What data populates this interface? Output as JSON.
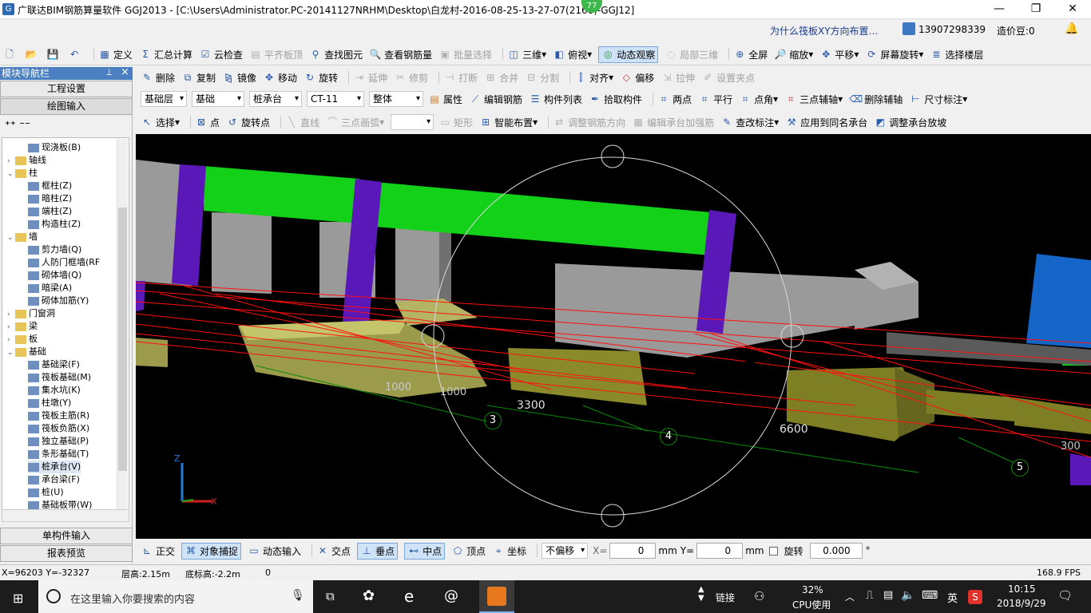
{
  "window": {
    "title": "广联达BIM钢筋算量软件 GGJ2013 - [C:\\Users\\Administrator.PC-20141127NRHM\\Desktop\\白龙村-2016-08-25-13-27-07(2166)-GGJ12]",
    "badge": "77",
    "minimize": "—",
    "maximize": "❐",
    "close": "✕"
  },
  "menubar": {
    "help_link": "为什么筏板XY方向布置…",
    "phone": "13907298339",
    "beans": "造价豆:0"
  },
  "toolbar1": {
    "define": "定义",
    "sum": "汇总计算",
    "cloud_check": "云检查",
    "flat_slab_top": "平齐板顶",
    "find_element": "查找图元",
    "view_rebar": "查看钢筋量",
    "batch_select": "批量选择",
    "three_d": "三维",
    "top_view": "俯视",
    "dynamic_observe": "动态观察",
    "local_3d": "局部三维",
    "fullscreen": "全屏",
    "zoom": "缩放",
    "pan": "平移",
    "screen_rotate": "屏幕旋转",
    "select_floor": "选择楼层"
  },
  "toolbar2": {
    "delete": "删除",
    "copy": "复制",
    "mirror": "镜像",
    "move": "移动",
    "rotate": "旋转",
    "extend": "延伸",
    "trim": "修剪",
    "break": "打断",
    "merge": "合并",
    "split": "分割",
    "align": "对齐",
    "offset": "偏移",
    "stretch": "拉伸",
    "set_grip": "设置夹点"
  },
  "toolbar3": {
    "layer": "基础层",
    "category": "基础",
    "element_type": "桩承台",
    "element_name": "CT-11",
    "scope": "整体",
    "property": "属性",
    "edit_rebar": "编辑钢筋",
    "element_list": "构件列表",
    "pick_element": "拾取构件",
    "two_points": "两点",
    "parallel": "平行",
    "point_angle": "点角",
    "three_point_axis": "三点辅轴",
    "delete_axis": "删除辅轴",
    "dimension": "尺寸标注"
  },
  "toolbar4": {
    "select": "选择",
    "point": "点",
    "rotate_point": "旋转点",
    "line": "直线",
    "three_point_arc": "三点画弧",
    "rect": "矩形",
    "smart_layout": "智能布置",
    "adjust_rebar_dir": "调整钢筋方向",
    "edit_cap_reinforce": "编辑承台加强筋",
    "modify_annotation": "查改标注",
    "apply_same_cap": "应用到同名承台",
    "adjust_cap_slope": "调整承台放坡"
  },
  "nav": {
    "header": "模块导航栏",
    "pin": "ꟷ",
    "close": "×",
    "project_settings": "工程设置",
    "drawing_input": "绘图输入",
    "single_input": "单构件输入",
    "report_preview": "报表预览",
    "tree": [
      {
        "label": "现浇板(B)",
        "level": 2,
        "type": "leaf"
      },
      {
        "label": "轴线",
        "level": 1,
        "type": "folder",
        "exp": "+"
      },
      {
        "label": "柱",
        "level": 1,
        "type": "folder",
        "exp": "−"
      },
      {
        "label": "框柱(Z)",
        "level": 2,
        "type": "leaf"
      },
      {
        "label": "暗柱(Z)",
        "level": 2,
        "type": "leaf"
      },
      {
        "label": "端柱(Z)",
        "level": 2,
        "type": "leaf"
      },
      {
        "label": "构造柱(Z)",
        "level": 2,
        "type": "leaf"
      },
      {
        "label": "墙",
        "level": 1,
        "type": "folder",
        "exp": "−"
      },
      {
        "label": "剪力墙(Q)",
        "level": 2,
        "type": "leaf"
      },
      {
        "label": "人防门框墙(RF",
        "level": 2,
        "type": "leaf"
      },
      {
        "label": "砌体墙(Q)",
        "level": 2,
        "type": "leaf"
      },
      {
        "label": "暗梁(A)",
        "level": 2,
        "type": "leaf"
      },
      {
        "label": "砌体加筋(Y)",
        "level": 2,
        "type": "leaf"
      },
      {
        "label": "门窗洞",
        "level": 1,
        "type": "folder",
        "exp": "+"
      },
      {
        "label": "梁",
        "level": 1,
        "type": "folder",
        "exp": "+"
      },
      {
        "label": "板",
        "level": 1,
        "type": "folder",
        "exp": "+"
      },
      {
        "label": "基础",
        "level": 1,
        "type": "folder",
        "exp": "−"
      },
      {
        "label": "基础梁(F)",
        "level": 2,
        "type": "leaf"
      },
      {
        "label": "筏板基础(M)",
        "level": 2,
        "type": "leaf"
      },
      {
        "label": "集水坑(K)",
        "level": 2,
        "type": "leaf"
      },
      {
        "label": "柱墩(Y)",
        "level": 2,
        "type": "leaf"
      },
      {
        "label": "筏板主筋(R)",
        "level": 2,
        "type": "leaf"
      },
      {
        "label": "筏板负筋(X)",
        "level": 2,
        "type": "leaf"
      },
      {
        "label": "独立基础(P)",
        "level": 2,
        "type": "leaf"
      },
      {
        "label": "条形基础(T)",
        "level": 2,
        "type": "leaf"
      },
      {
        "label": "桩承台(V)",
        "level": 2,
        "type": "leaf",
        "selected": true
      },
      {
        "label": "承台梁(F)",
        "level": 2,
        "type": "leaf"
      },
      {
        "label": "桩(U)",
        "level": 2,
        "type": "leaf"
      },
      {
        "label": "基础板带(W)",
        "level": 2,
        "type": "leaf"
      }
    ]
  },
  "view": {
    "dims": [
      "1000",
      "1000",
      "3300",
      "6600",
      "300"
    ],
    "axes": [
      "3",
      "4",
      "5"
    ],
    "axis_z": "Z",
    "axis_x": "X"
  },
  "bottombar": {
    "ortho": "正交",
    "snap": "对象捕捉",
    "dynamic_input": "动态输入",
    "intersect": "交点",
    "perpendicular": "垂点",
    "midpoint": "中点",
    "vertex": "顶点",
    "coord": "坐标",
    "offset_mode": "不偏移",
    "x_label": "X=",
    "x_value": "0",
    "y_label": "Y=",
    "y_value": "0",
    "unit": "mm",
    "rotate_label": "旋转",
    "rotate_value": "0.000",
    "degree": "°"
  },
  "status": {
    "coords": "X=96203 Y=-32327",
    "floor_height": "层高:2.15m",
    "bottom_height": "底标高:-2.2m",
    "zero": "0",
    "fps": "168.9 FPS"
  },
  "taskbar": {
    "search_placeholder": "在这里输入你要搜索的内容",
    "link": "链接",
    "cpu_percent": "32%",
    "cpu_label": "CPU使用",
    "ime": "英",
    "time": "10:15",
    "date": "2018/9/29"
  }
}
